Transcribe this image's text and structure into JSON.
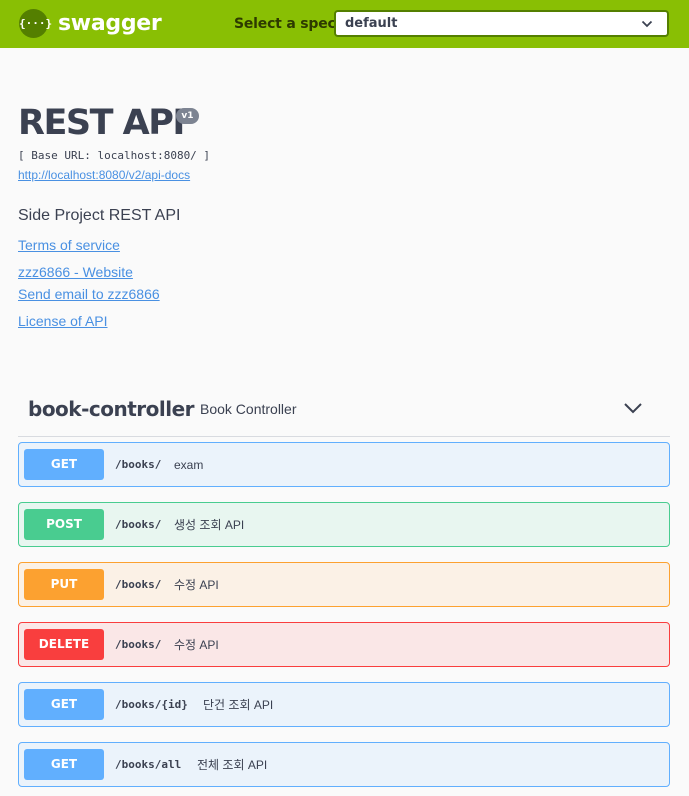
{
  "topbar": {
    "logo_glyph": "{···}",
    "brand": "swagger",
    "spec_label": "Select a spec",
    "spec_selected": "default",
    "colors": {
      "bar": "#89bf04",
      "logo_badge": "#547f00",
      "select_border": "#547f00"
    }
  },
  "info": {
    "title": "REST API",
    "version": "v1",
    "base_url": "[ Base URL: localhost:8080/ ]",
    "docs_link": "http://localhost:8080/v2/api-docs",
    "description": "Side Project REST API",
    "links": {
      "terms": "Terms of service",
      "website": "zzz6866 - Website",
      "email": "Send email to zzz6866",
      "license": "License of API"
    }
  },
  "tag": {
    "name": "book-controller",
    "description": "Book Controller",
    "chevron_icon": "chevron-down-icon"
  },
  "operations": [
    {
      "method": "GET",
      "path": "/books/",
      "summary": "exam",
      "color": "#61affe"
    },
    {
      "method": "POST",
      "path": "/books/",
      "summary": "생성 조회 API",
      "color": "#49cc90"
    },
    {
      "method": "PUT",
      "path": "/books/",
      "summary": "수정 API",
      "color": "#fca130"
    },
    {
      "method": "DELETE",
      "path": "/books/",
      "summary": "수정 API",
      "color": "#f93e3e"
    },
    {
      "method": "GET",
      "path": "/books/{id}",
      "summary": "단건 조회 API",
      "color": "#61affe"
    },
    {
      "method": "GET",
      "path": "/books/all",
      "summary": "전체 조회 API",
      "color": "#61affe"
    }
  ]
}
